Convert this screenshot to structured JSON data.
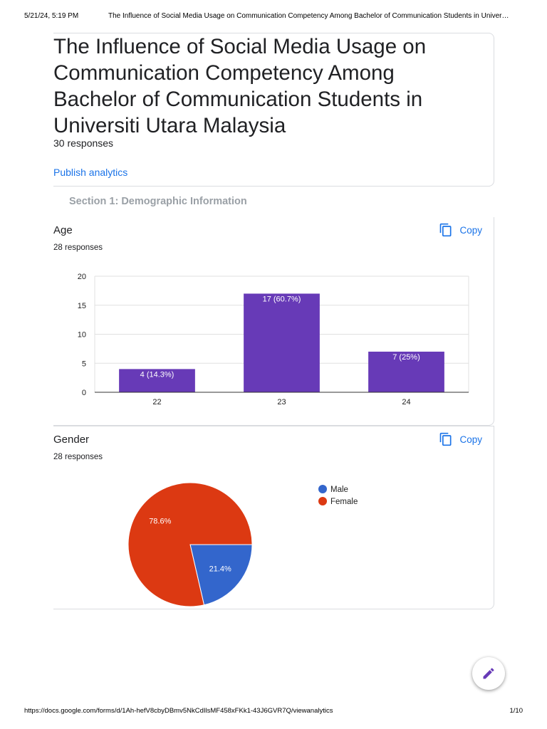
{
  "print_header": {
    "date": "5/21/24, 5:19 PM",
    "doc_title": "The Influence of Social Media Usage on Communication Competency Among Bachelor of Communication Students in Univer…"
  },
  "form": {
    "title": "The Influence of Social Media Usage on Communication Competency Among Bachelor of Communication Students in Universiti Utara Malaysia",
    "responses": "30 responses",
    "publish_label": "Publish analytics"
  },
  "section": {
    "title": "Section 1: Demographic Information"
  },
  "questions": {
    "age": {
      "title": "Age",
      "count": "28 responses",
      "copy_label": "Copy"
    },
    "gender": {
      "title": "Gender",
      "count": "28 responses",
      "copy_label": "Copy"
    }
  },
  "colors": {
    "accent": "#1a73e8",
    "bar": "#673ab7",
    "male": "#3366cc",
    "female": "#dc3912",
    "edit_icon": "#673ab7"
  },
  "icons": {
    "copy": "copy-icon",
    "edit": "pencil-icon"
  },
  "chart_data": [
    {
      "type": "bar",
      "title": "Age",
      "categories": [
        "22",
        "23",
        "24"
      ],
      "values": [
        4,
        17,
        7
      ],
      "data_labels": [
        "4 (14.3%)",
        "17 (60.7%)",
        "7 (25%)"
      ],
      "ylim": [
        0,
        20
      ],
      "yticks": [
        0,
        5,
        10,
        15,
        20
      ],
      "grid": true
    },
    {
      "type": "pie",
      "title": "Gender",
      "labels": [
        "Male",
        "Female"
      ],
      "values": [
        21.4,
        78.6
      ],
      "data_labels": [
        "21.4%",
        "78.6%"
      ],
      "colors": [
        "#3366cc",
        "#dc3912"
      ],
      "legend": "right"
    }
  ],
  "print_footer": {
    "url": "https://docs.google.com/forms/d/1Ah-hefV8cbyDBmv5NkCdIlsMF458xFKk1-43J6GVR7Q/viewanalytics",
    "page": "1/10"
  }
}
